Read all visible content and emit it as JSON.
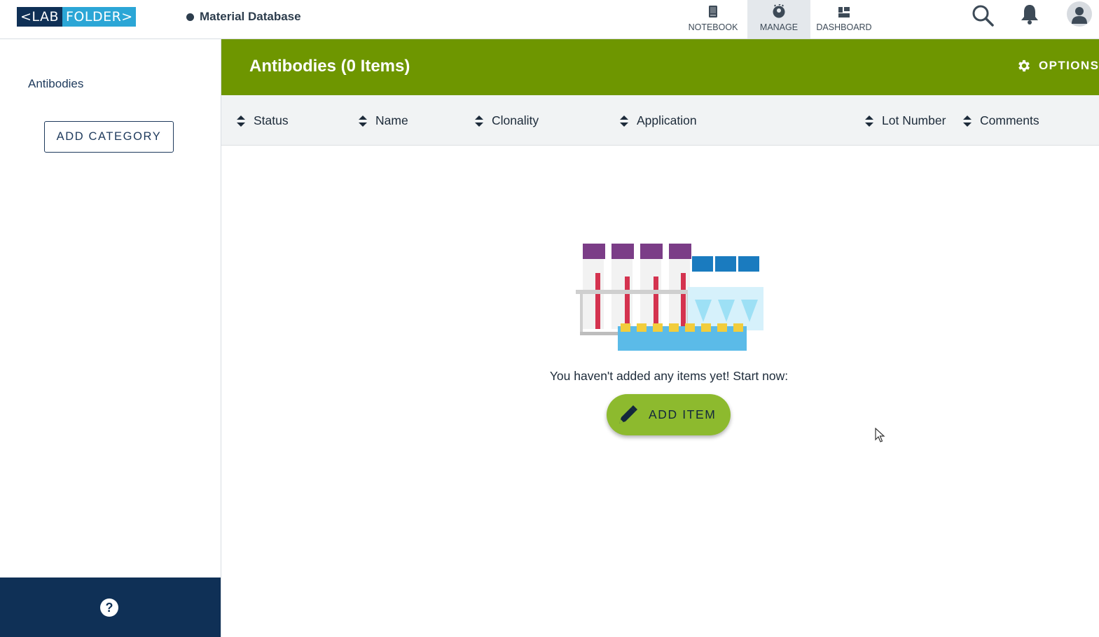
{
  "logo": {
    "part1": "<LAB",
    "part2": "FOLDER>"
  },
  "breadcrumb": {
    "label": "Material Database"
  },
  "nav": {
    "notebook": "NOTEBOOK",
    "manage": "MANAGE",
    "dashboard": "DASHBOARD"
  },
  "sidebar": {
    "category": "Antibodies",
    "add_category": "ADD CATEGORY",
    "help": "?"
  },
  "header": {
    "title": "Antibodies (0 Items)",
    "options": "OPTIONS"
  },
  "columns": [
    "Status",
    "Name",
    "Clonality",
    "Application",
    "Lot Number",
    "Comments"
  ],
  "empty_state": {
    "message": "You haven't added any items yet! Start now:",
    "add_item": "ADD ITEM"
  },
  "colors": {
    "brand_dark": "#0f3056",
    "brand_light": "#2ba6d6",
    "header_green": "#6e9600",
    "button_green": "#8dba2e"
  },
  "icons": [
    "notebook-icon",
    "manage-icon",
    "dashboard-icon",
    "search-icon",
    "bell-icon",
    "avatar-icon",
    "gear-icon",
    "sort-icon",
    "pencil-icon",
    "help-icon"
  ]
}
